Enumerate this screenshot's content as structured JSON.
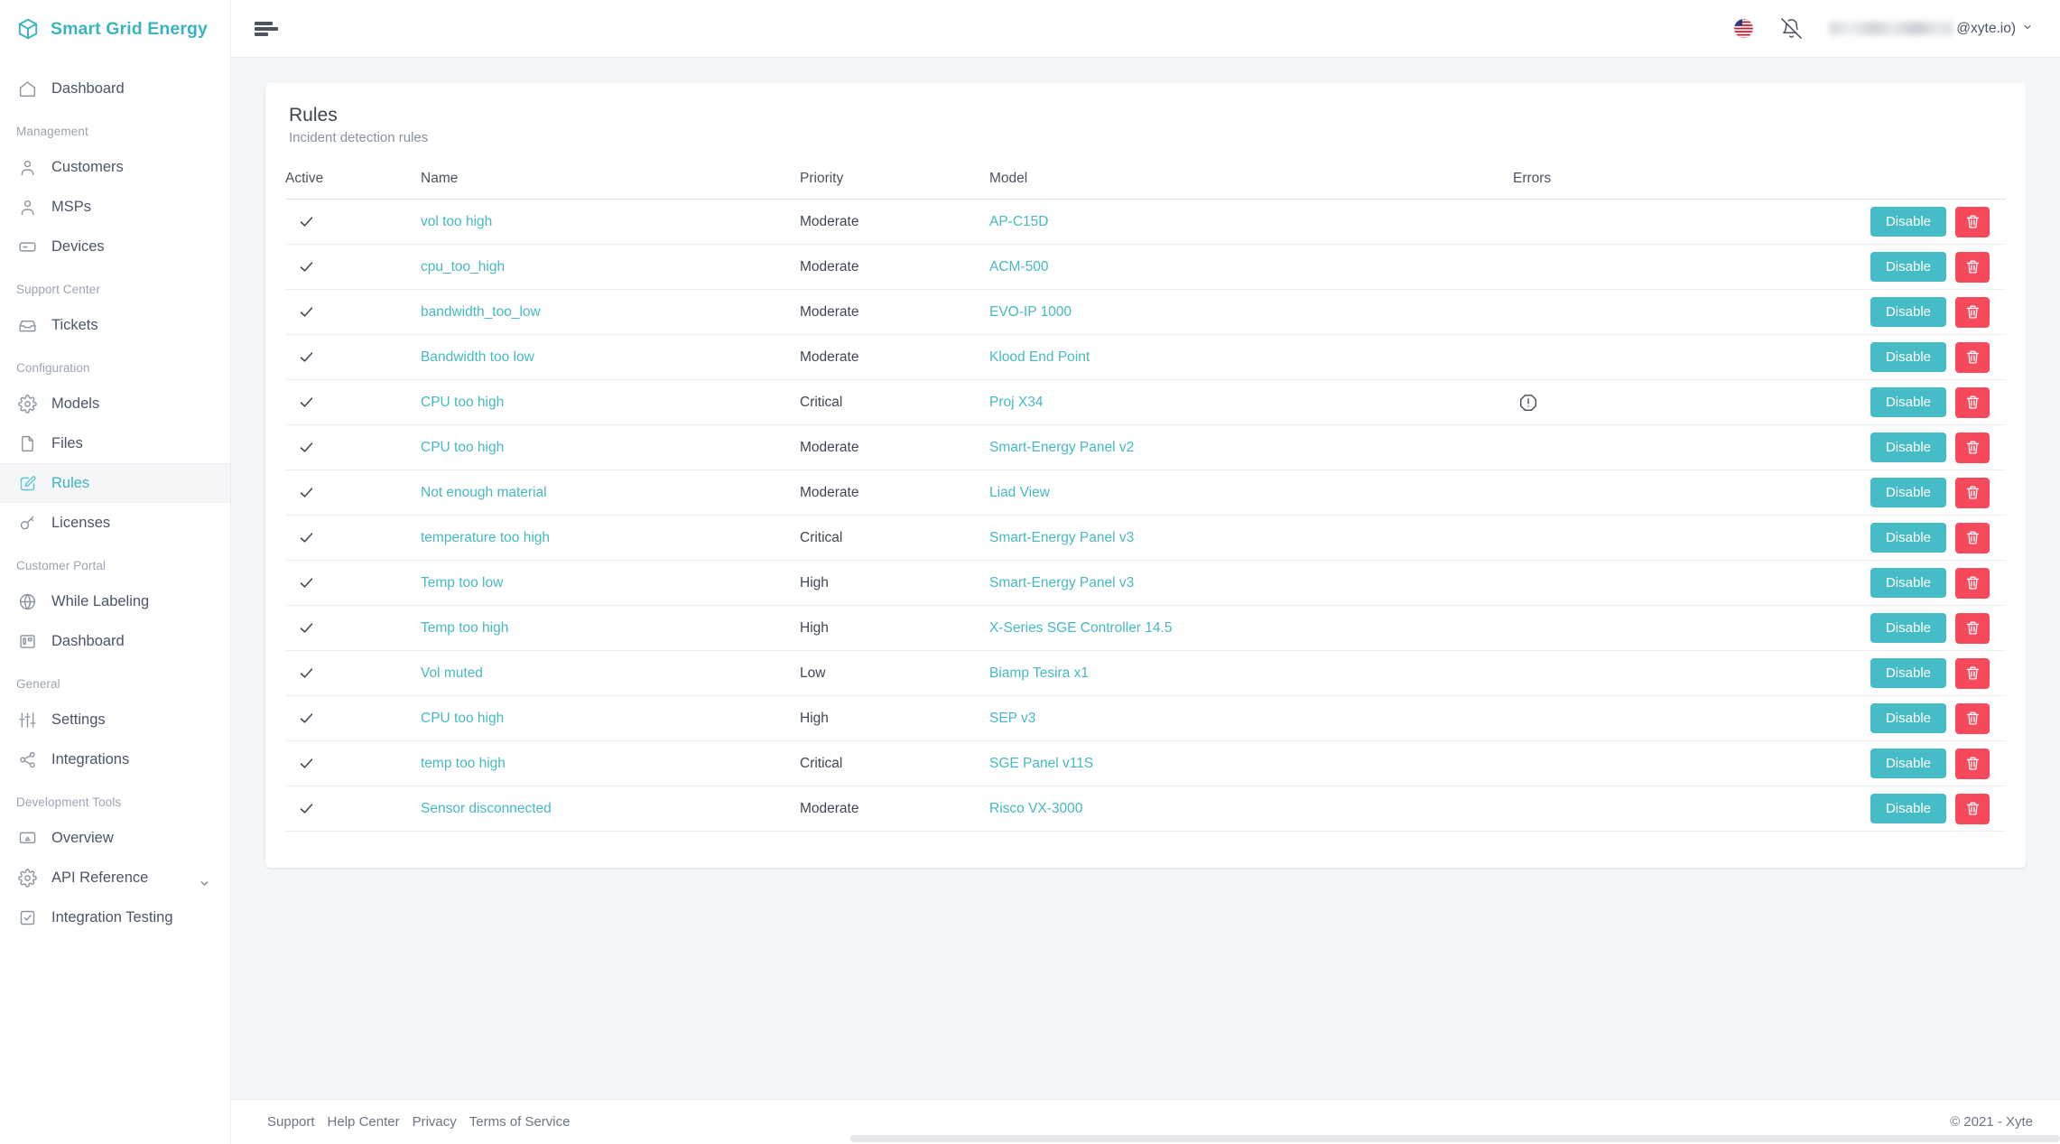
{
  "brand": {
    "name": "Smart Grid Energy",
    "logo_icon": "cube-icon"
  },
  "sidebar": {
    "groups": [
      {
        "label": "",
        "items": [
          {
            "label": "Dashboard",
            "icon": "home-icon",
            "active": false
          }
        ]
      },
      {
        "label": "Management",
        "items": [
          {
            "label": "Customers",
            "icon": "user-icon",
            "active": false
          },
          {
            "label": "MSPs",
            "icon": "user-icon",
            "active": false
          },
          {
            "label": "Devices",
            "icon": "device-icon",
            "active": false
          }
        ]
      },
      {
        "label": "Support Center",
        "items": [
          {
            "label": "Tickets",
            "icon": "inbox-icon",
            "active": false
          }
        ]
      },
      {
        "label": "Configuration",
        "items": [
          {
            "label": "Models",
            "icon": "gear-icon",
            "active": false
          },
          {
            "label": "Files",
            "icon": "file-icon",
            "active": false
          },
          {
            "label": "Rules",
            "icon": "edit-square-icon",
            "active": true
          },
          {
            "label": "Licenses",
            "icon": "key-icon",
            "active": false
          }
        ]
      },
      {
        "label": "Customer Portal",
        "items": [
          {
            "label": "While Labeling",
            "icon": "globe-icon",
            "active": false
          },
          {
            "label": "Dashboard",
            "icon": "dashboard-icon",
            "active": false
          }
        ]
      },
      {
        "label": "General",
        "items": [
          {
            "label": "Settings",
            "icon": "sliders-icon",
            "active": false
          },
          {
            "label": "Integrations",
            "icon": "share-icon",
            "active": false
          }
        ]
      },
      {
        "label": "Development Tools",
        "items": [
          {
            "label": "Overview",
            "icon": "monitor-icon",
            "active": false
          },
          {
            "label": "API Reference",
            "icon": "gear-icon",
            "active": false,
            "chevron": "chevron-down-icon"
          },
          {
            "label": "Integration Testing",
            "icon": "check-square-icon",
            "active": false
          }
        ]
      }
    ]
  },
  "topbar": {
    "menu_icon": "hamburger-icon",
    "flag_icon": "us-flag-icon",
    "notifications_icon": "bell-off-icon",
    "user_email_suffix": "@xyte.io)",
    "caret_icon": "chevron-down-icon"
  },
  "page": {
    "title": "Rules",
    "subtitle": "Incident detection rules"
  },
  "table": {
    "columns": [
      "Active",
      "Name",
      "Priority",
      "Model",
      "Errors",
      ""
    ],
    "disable_label": "Disable",
    "delete_icon": "trash-icon",
    "active_icon": "check-icon",
    "error_icon": "alert-octagon-icon",
    "rows": [
      {
        "active": true,
        "name": "vol too high",
        "priority": "Moderate",
        "model": "AP-C15D",
        "error": false
      },
      {
        "active": true,
        "name": "cpu_too_high",
        "priority": "Moderate",
        "model": "ACM-500",
        "error": false
      },
      {
        "active": true,
        "name": "bandwidth_too_low",
        "priority": "Moderate",
        "model": "EVO-IP 1000",
        "error": false
      },
      {
        "active": true,
        "name": "Bandwidth too low",
        "priority": "Moderate",
        "model": "Klood End Point",
        "error": false
      },
      {
        "active": true,
        "name": "CPU too high",
        "priority": "Critical",
        "model": "Proj X34",
        "error": true
      },
      {
        "active": true,
        "name": "CPU too high",
        "priority": "Moderate",
        "model": "Smart-Energy Panel v2",
        "error": false
      },
      {
        "active": true,
        "name": "Not enough material",
        "priority": "Moderate",
        "model": "Liad View",
        "error": false
      },
      {
        "active": true,
        "name": "temperature too high",
        "priority": "Critical",
        "model": "Smart-Energy Panel v3",
        "error": false
      },
      {
        "active": true,
        "name": "Temp too low",
        "priority": "High",
        "model": "Smart-Energy Panel v3",
        "error": false
      },
      {
        "active": true,
        "name": "Temp too high",
        "priority": "High",
        "model": "X-Series SGE Controller 14.5",
        "error": false
      },
      {
        "active": true,
        "name": "Vol muted",
        "priority": "Low",
        "model": "Biamp Tesira x1",
        "error": false
      },
      {
        "active": true,
        "name": "CPU too high",
        "priority": "High",
        "model": "SEP v3",
        "error": false
      },
      {
        "active": true,
        "name": "temp too high",
        "priority": "Critical",
        "model": "SGE Panel v11S",
        "error": false
      },
      {
        "active": true,
        "name": "Sensor disconnected",
        "priority": "Moderate",
        "model": "Risco VX-3000",
        "error": false
      }
    ]
  },
  "footer": {
    "links": [
      "Support",
      "Help Center",
      "Privacy",
      "Terms of Service"
    ],
    "copyright": "© 2021 - Xyte"
  },
  "colors": {
    "accent_teal": "#46b9c4",
    "brand_teal": "#3ab5c0",
    "danger_red": "#f6495c",
    "page_bg": "#f4f7fa"
  }
}
